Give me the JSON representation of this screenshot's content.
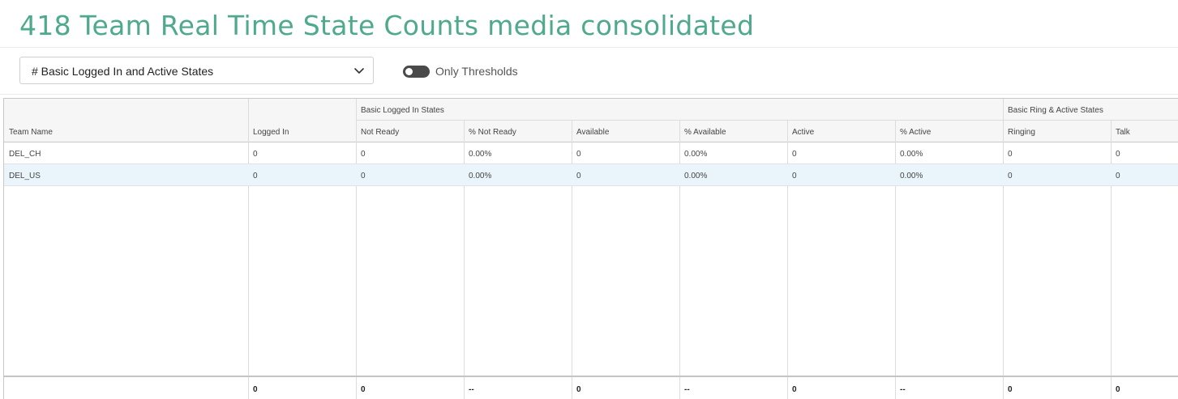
{
  "page": {
    "title": "418 Team Real Time State Counts media consolidated"
  },
  "controls": {
    "view_select": {
      "selected": "# Basic Logged In and Active States",
      "icon": "chevron-down-icon"
    },
    "threshold_toggle": {
      "label": "Only Thresholds",
      "on": false
    }
  },
  "table": {
    "groups": [
      {
        "label": "Basic Logged In States"
      },
      {
        "label": "Basic Ring & Active States"
      }
    ],
    "columns": [
      "Team Name",
      "Logged In",
      "Not Ready",
      "% Not Ready",
      "Available",
      "% Available",
      "Active",
      "% Active",
      "Ringing",
      "Talk"
    ],
    "rows": [
      [
        "DEL_CH",
        "0",
        "0",
        "0.00%",
        "0",
        "0.00%",
        "0",
        "0.00%",
        "0",
        "0"
      ],
      [
        "DEL_US",
        "0",
        "0",
        "0.00%",
        "0",
        "0.00%",
        "0",
        "0.00%",
        "0",
        "0"
      ]
    ],
    "selected_row": 1,
    "totals": [
      "",
      "0",
      "0",
      "--",
      "0",
      "--",
      "0",
      "--",
      "0",
      "0"
    ]
  },
  "colors": {
    "title": "#4fa98d",
    "selected_row": "#eaf5fb",
    "header_background": "#f6f6f6"
  }
}
